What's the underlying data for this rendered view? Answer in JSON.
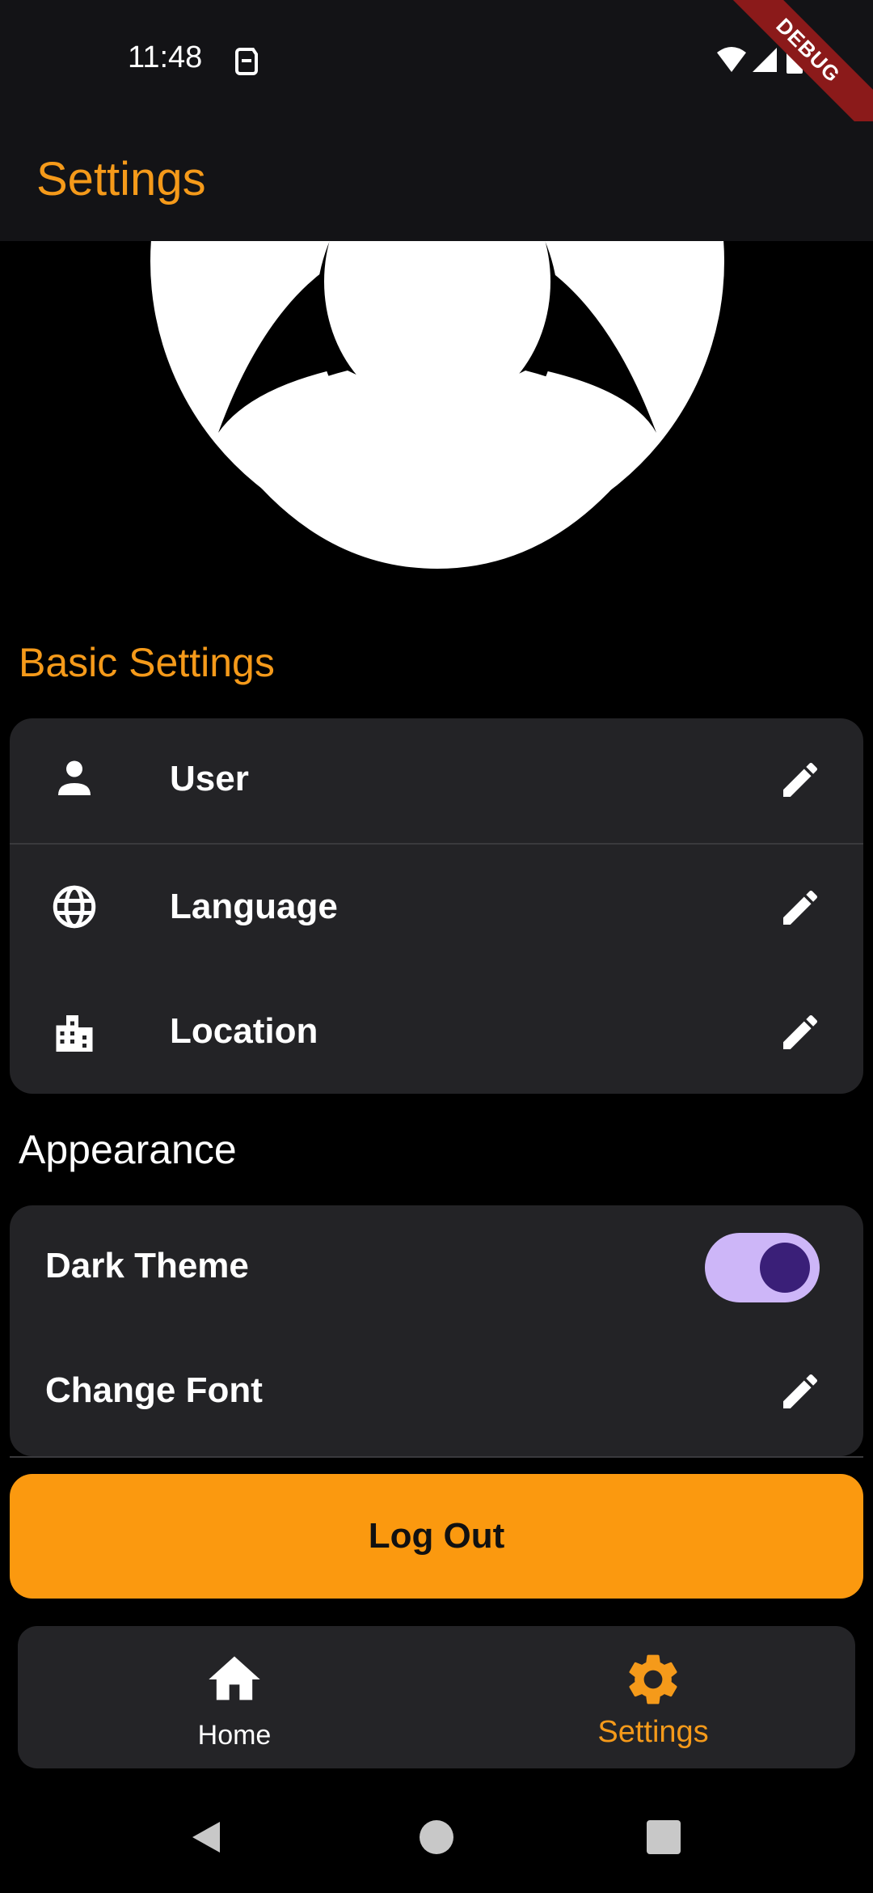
{
  "status_bar": {
    "time": "11:48",
    "debug_label": "DEBUG"
  },
  "app_bar": {
    "title": "Settings"
  },
  "colors": {
    "accent": "#f59a1a",
    "card_bg": "#232326",
    "toggle_track": "#cdb6f8",
    "toggle_knob": "#3a1f78",
    "logout_bg": "#fb990f"
  },
  "basic_settings": {
    "title": "Basic Settings",
    "items": [
      {
        "label": "User",
        "icon": "person-icon",
        "action_icon": "edit-icon"
      },
      {
        "label": "Language",
        "icon": "globe-icon",
        "action_icon": "edit-icon"
      },
      {
        "label": "Location",
        "icon": "city-icon",
        "action_icon": "edit-icon"
      }
    ]
  },
  "appearance": {
    "title": "Appearance",
    "dark_theme": {
      "label": "Dark Theme",
      "enabled": true
    },
    "change_font": {
      "label": "Change Font",
      "action_icon": "edit-icon"
    }
  },
  "logout": {
    "label": "Log Out"
  },
  "bottom_nav": {
    "items": [
      {
        "label": "Home",
        "icon": "home-icon",
        "active": false
      },
      {
        "label": "Settings",
        "icon": "gear-icon",
        "active": true
      }
    ]
  }
}
